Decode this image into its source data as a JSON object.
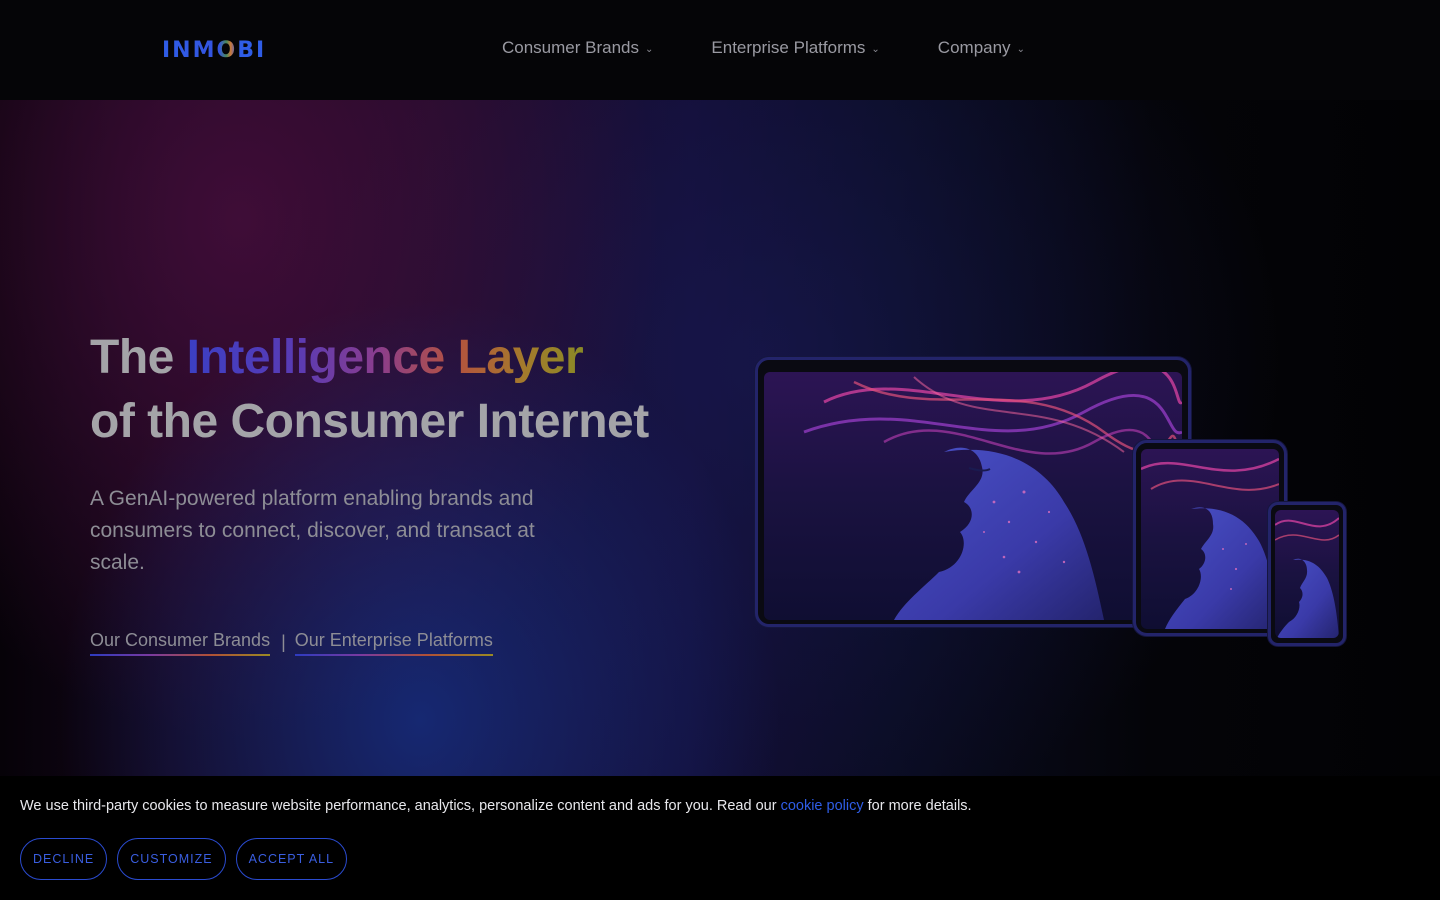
{
  "header": {
    "logo_text": "INMOBI",
    "nav": [
      {
        "label": "Consumer Brands"
      },
      {
        "label": "Enterprise Platforms"
      },
      {
        "label": "Company"
      }
    ]
  },
  "hero": {
    "headline_prefix": "The ",
    "headline_highlight": "Intelligence Layer",
    "headline_line2": "of the Consumer Internet",
    "subtitle": "A GenAI-powered platform enabling brands and consumers to connect, discover, and transact at scale.",
    "links": [
      {
        "label": "Our Consumer Brands"
      },
      {
        "label": "Our Enterprise Platforms"
      }
    ],
    "link_separator": "|"
  },
  "cookie_banner": {
    "text_before": "We use third-party cookies to measure website performance, analytics, personalize content and ads for you. Read our ",
    "link_text": "cookie policy",
    "text_after": " for more details.",
    "buttons": {
      "decline": "DECLINE",
      "customize": "CUSTOMIZE",
      "accept": "ACCEPT ALL"
    }
  },
  "colors": {
    "accent_blue": "#2f5de6",
    "background": "#030308"
  }
}
